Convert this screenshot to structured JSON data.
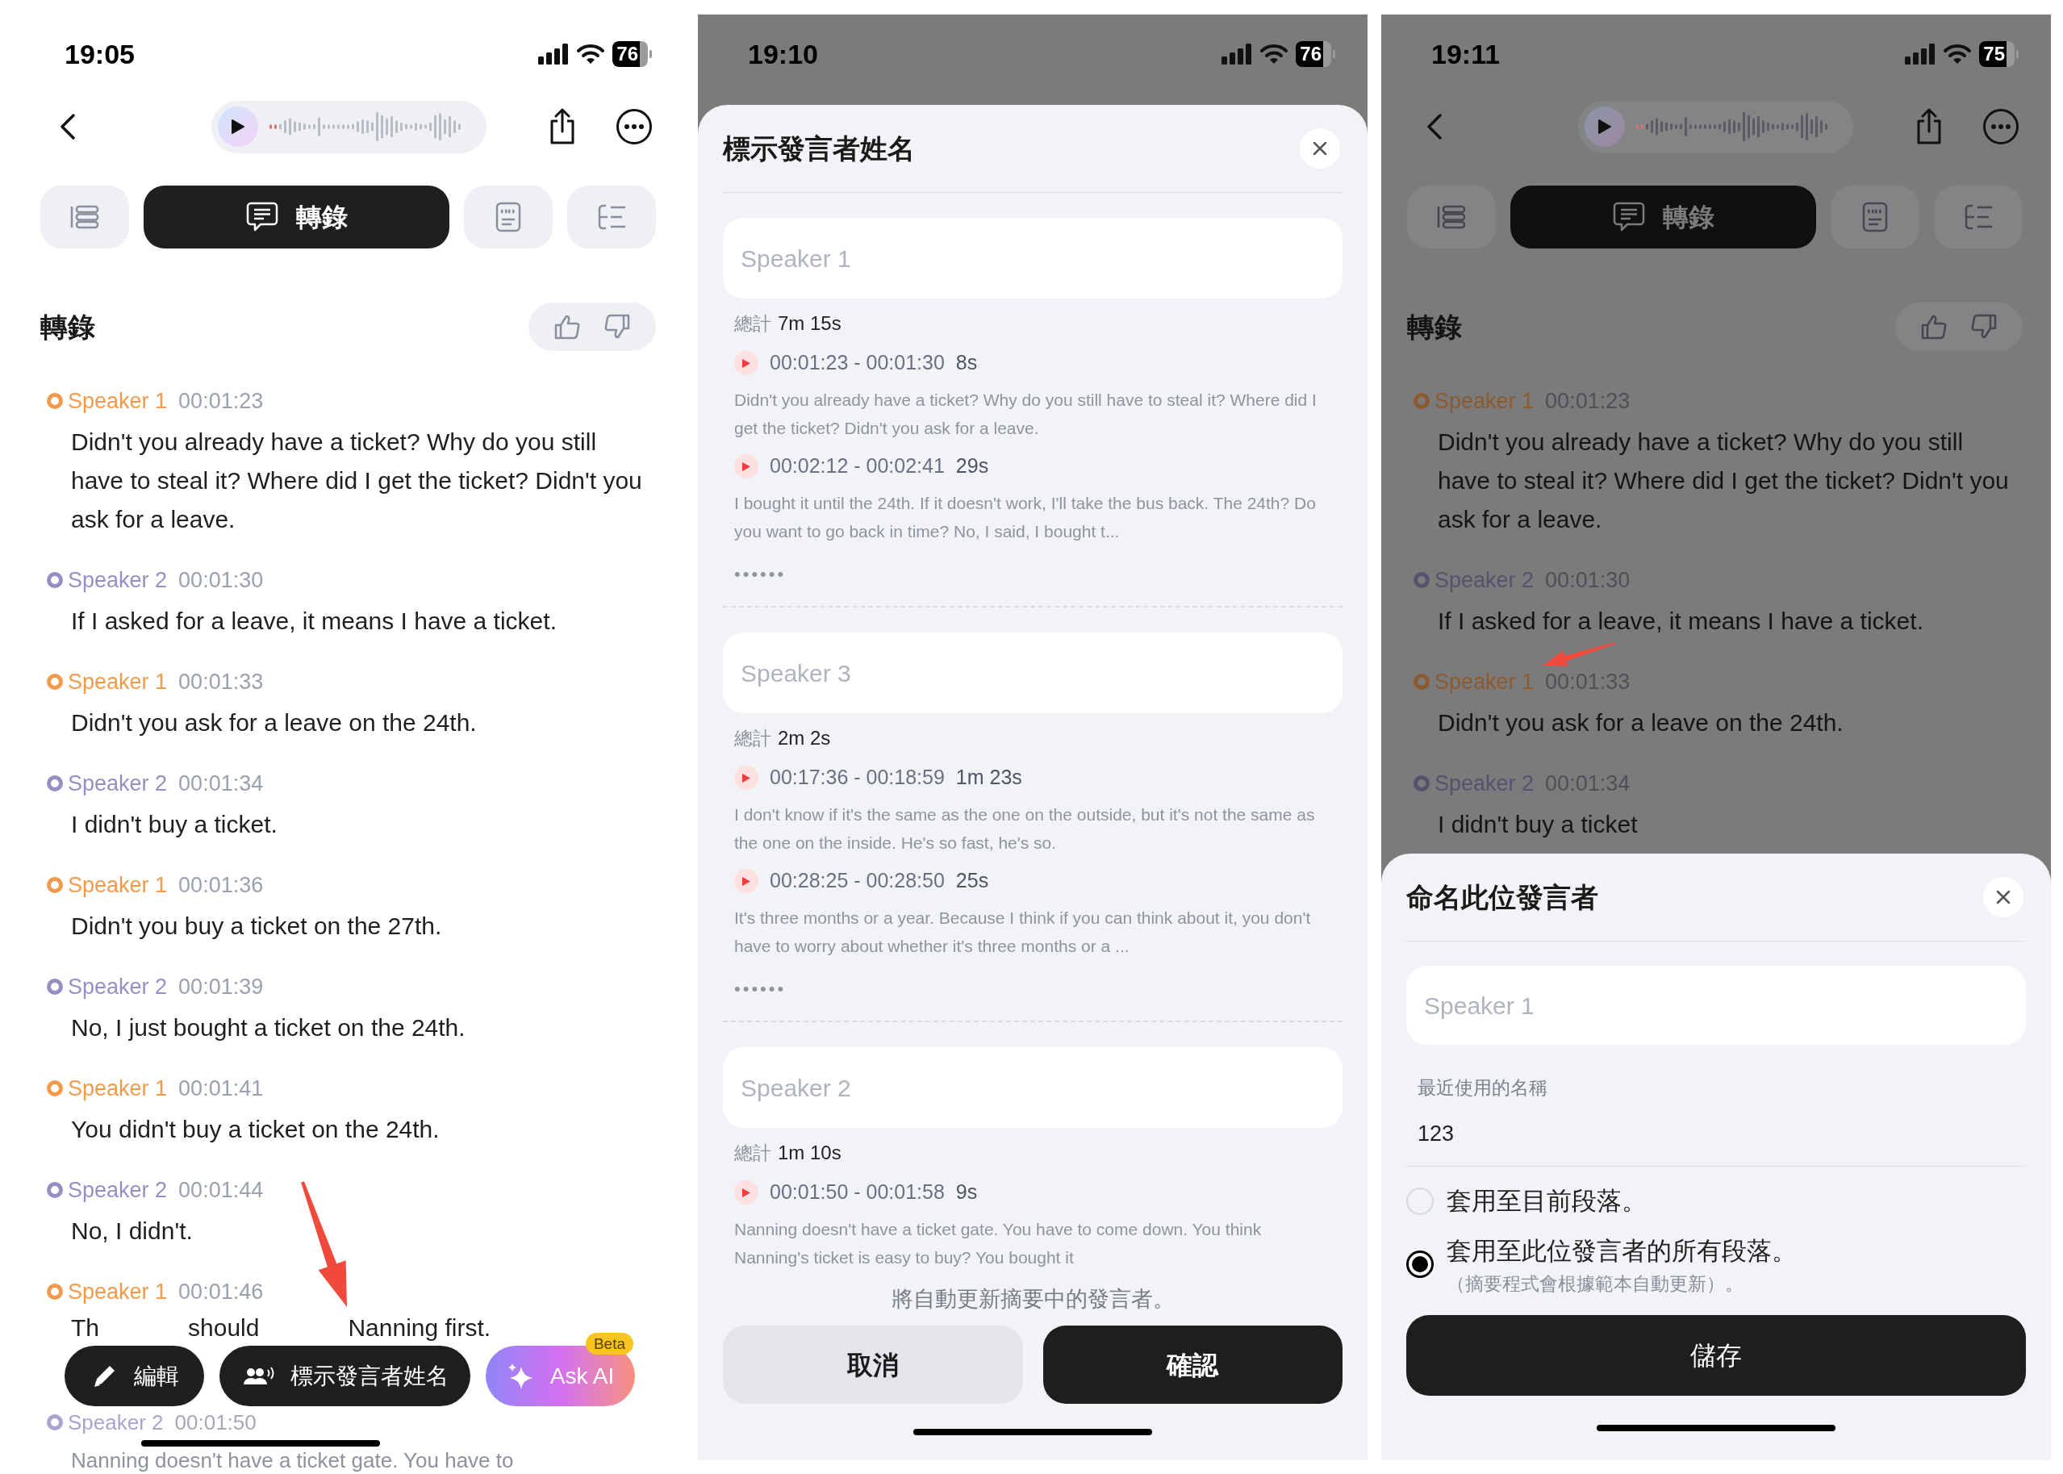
{
  "screens": [
    {
      "dimmed": false,
      "annotation_arrow": true,
      "status": {
        "time": "19:05",
        "battery": "76"
      },
      "app": {
        "tabs": [
          {
            "selected": false
          },
          {
            "label": "轉錄",
            "selected": true
          },
          {
            "selected": false
          },
          {
            "selected": false
          }
        ],
        "heading": "轉錄",
        "entries": [
          {
            "speaker": "Speaker 1",
            "color": "#f19a4c",
            "time": "00:01:23",
            "text": "Didn't you already have a ticket? Why do you still have to steal it? Where did I get the ticket? Didn't you ask for a leave."
          },
          {
            "speaker": "Speaker 2",
            "color": "#968fc4",
            "time": "00:01:30",
            "text": "If I asked for a leave, it means I have a ticket."
          },
          {
            "speaker": "Speaker 1",
            "color": "#f19a4c",
            "time": "00:01:33",
            "text": "Didn't you ask for a leave on the 24th."
          },
          {
            "speaker": "Speaker 2",
            "color": "#968fc4",
            "time": "00:01:34",
            "text": "I didn't buy a ticket."
          },
          {
            "speaker": "Speaker 1",
            "color": "#f19a4c",
            "time": "00:01:36",
            "text": "Didn't you buy a ticket on the 27th."
          },
          {
            "speaker": "Speaker 2",
            "color": "#968fc4",
            "time": "00:01:39",
            "text": "No, I just bought a ticket on the 24th."
          },
          {
            "speaker": "Speaker 1",
            "color": "#f19a4c",
            "time": "00:01:41",
            "text": "You didn't buy a ticket on the 24th."
          },
          {
            "speaker": "Speaker 2",
            "color": "#968fc4",
            "time": "00:01:44",
            "text": "No, I didn't."
          }
        ],
        "covered_entry": {
          "speaker": "Speaker 1",
          "color": "#f19a4c",
          "time": "00:01:46",
          "fragments": [
            "Th",
            "should",
            "Nanning first."
          ]
        },
        "actions": [
          {
            "kind": "edit",
            "label": "編輯"
          },
          {
            "kind": "speakers",
            "label": "標示發言者姓名"
          },
          {
            "kind": "ai",
            "label": "Ask AI",
            "badge": "Beta"
          }
        ],
        "faded_entry": {
          "speaker": "Speaker 2",
          "color": "#a9a3d2",
          "time": "00:01:50",
          "text": "Nanning doesn't have a ticket gate. You have to"
        }
      }
    },
    {
      "dimmed": true,
      "annotation_arrow": false,
      "status": {
        "time": "19:10",
        "battery": "76"
      },
      "sheet": {
        "kind": "speaker_list",
        "title": "標示發言者姓名",
        "speakers": [
          {
            "placeholder": "Speaker 1",
            "total_label": "總計",
            "total": "7m 15s",
            "more": "••••••",
            "segments": [
              {
                "range": "00:01:23 - 00:01:30",
                "duration": "8s",
                "text": "Didn't you already have a ticket? Why do you still have to steal it? Where did I get the ticket? Didn't you ask for a leave."
              },
              {
                "range": "00:02:12 - 00:02:41",
                "duration": "29s",
                "text": "I bought it until the 24th. If it doesn't work, I'll take the bus back. The 24th? Do you want to go back in time? No, I said, I bought t..."
              }
            ]
          },
          {
            "placeholder": "Speaker 3",
            "total_label": "總計",
            "total": "2m 2s",
            "more": "••••••",
            "segments": [
              {
                "range": "00:17:36 - 00:18:59",
                "duration": "1m 23s",
                "text": "I don't know if it's the same as the one on the outside, but it's not the same as the one on the inside. He's so fast, he's so."
              },
              {
                "range": "00:28:25 - 00:28:50",
                "duration": "25s",
                "text": "It's three months or a year. Because I think if you can think about it, you don't have to worry about whether it's three months or a ..."
              }
            ]
          },
          {
            "placeholder": "Speaker 2",
            "total_label": "總計",
            "total": "1m 10s",
            "segments": [
              {
                "range": "00:01:50 - 00:01:58",
                "duration": "9s",
                "text": "Nanning doesn't have a ticket gate. You have to come down. You think Nanning's ticket is easy to buy? You bought it"
              }
            ]
          }
        ],
        "note": "將自動更新摘要中的發言者。",
        "cancel": "取消",
        "confirm": "確認"
      }
    },
    {
      "dimmed": true,
      "annotation_arrow": true,
      "status": {
        "time": "19:11",
        "battery": "75"
      },
      "app": {
        "tabs": [
          {
            "selected": false
          },
          {
            "label": "轉錄",
            "selected": true
          },
          {
            "selected": false
          },
          {
            "selected": false
          }
        ],
        "heading": "轉錄",
        "entries": [
          {
            "speaker": "Speaker 1",
            "color": "#8c5a30",
            "time": "00:01:23",
            "text": "Didn't you already have a ticket? Why do you still have to steal it? Where did I get the ticket? Didn't you ask for a leave."
          },
          {
            "speaker": "Speaker 2",
            "color": "#55526e",
            "time": "00:01:30",
            "text": "If I asked for a leave, it means I have a ticket."
          },
          {
            "speaker": "Speaker 1",
            "color": "#8c5a30",
            "time": "00:01:33",
            "text": "Didn't you ask for a leave on the 24th."
          },
          {
            "speaker": "Speaker 2",
            "color": "#55526e",
            "time": "00:01:34",
            "text": "I didn't buy a ticket"
          }
        ]
      },
      "sheet": {
        "kind": "rename",
        "title": "命名此位發言者",
        "placeholder": "Speaker 1",
        "recent_label": "最近使用的名稱",
        "recent": [
          "123"
        ],
        "options": [
          {
            "label": "套用至目前段落。",
            "selected": false
          },
          {
            "label": "套用至此位發言者的所有段落。",
            "note": "（摘要程式會根據範本自動更新）。",
            "selected": true
          }
        ],
        "save": "儲存"
      }
    }
  ]
}
